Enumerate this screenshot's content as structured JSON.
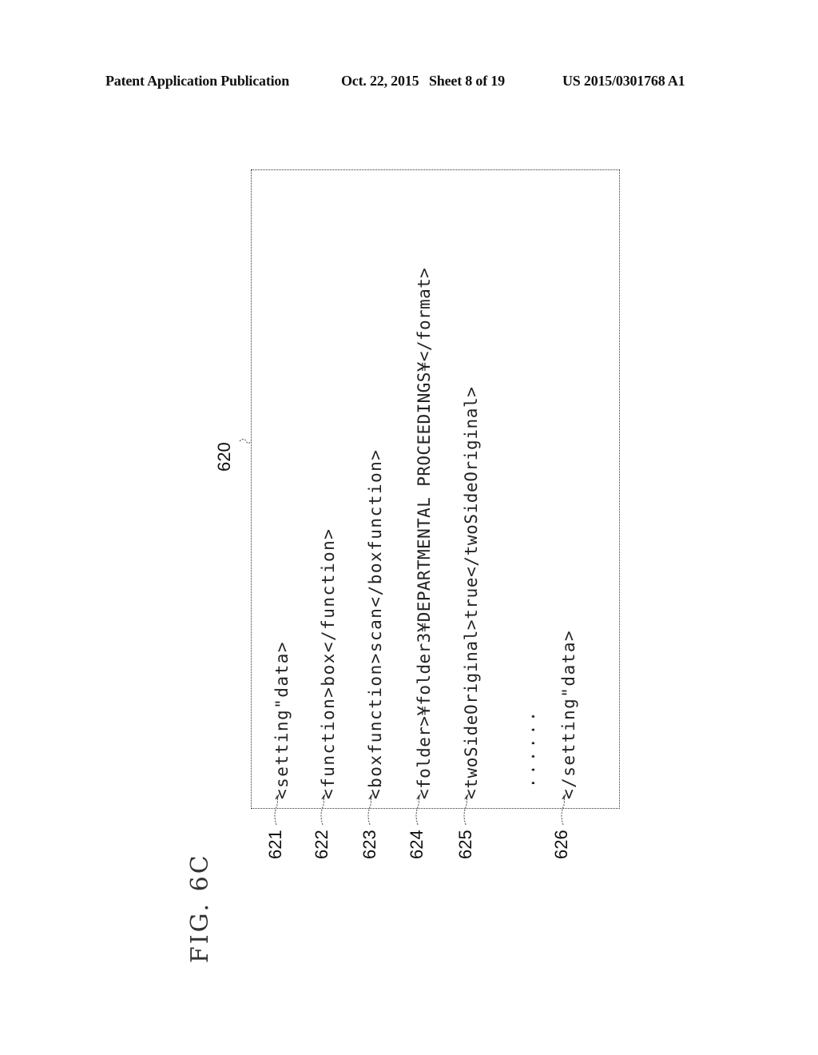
{
  "header": {
    "publication": "Patent Application Publication",
    "date": "Oct. 22, 2015",
    "sheet": "Sheet 8 of 19",
    "patent_number": "US 2015/0301768 A1"
  },
  "figure": {
    "label": "FIG. 6C",
    "box_ref": "620",
    "lines": [
      {
        "ref": "621",
        "text": "<setting\"data>"
      },
      {
        "ref": "622",
        "text": "<function>box</function>"
      },
      {
        "ref": "623",
        "text": "<boxfunction>scan</boxfunction>"
      },
      {
        "ref": "624",
        "text": "<folder>¥folder3¥DEPARTMENTAL PROCEEDINGS¥</format>"
      },
      {
        "ref": "625",
        "text": "<twoSideOriginal>true</twoSideOriginal>"
      },
      {
        "ref": "",
        "text": "......"
      },
      {
        "ref": "626",
        "text": "</setting\"data>"
      }
    ]
  }
}
